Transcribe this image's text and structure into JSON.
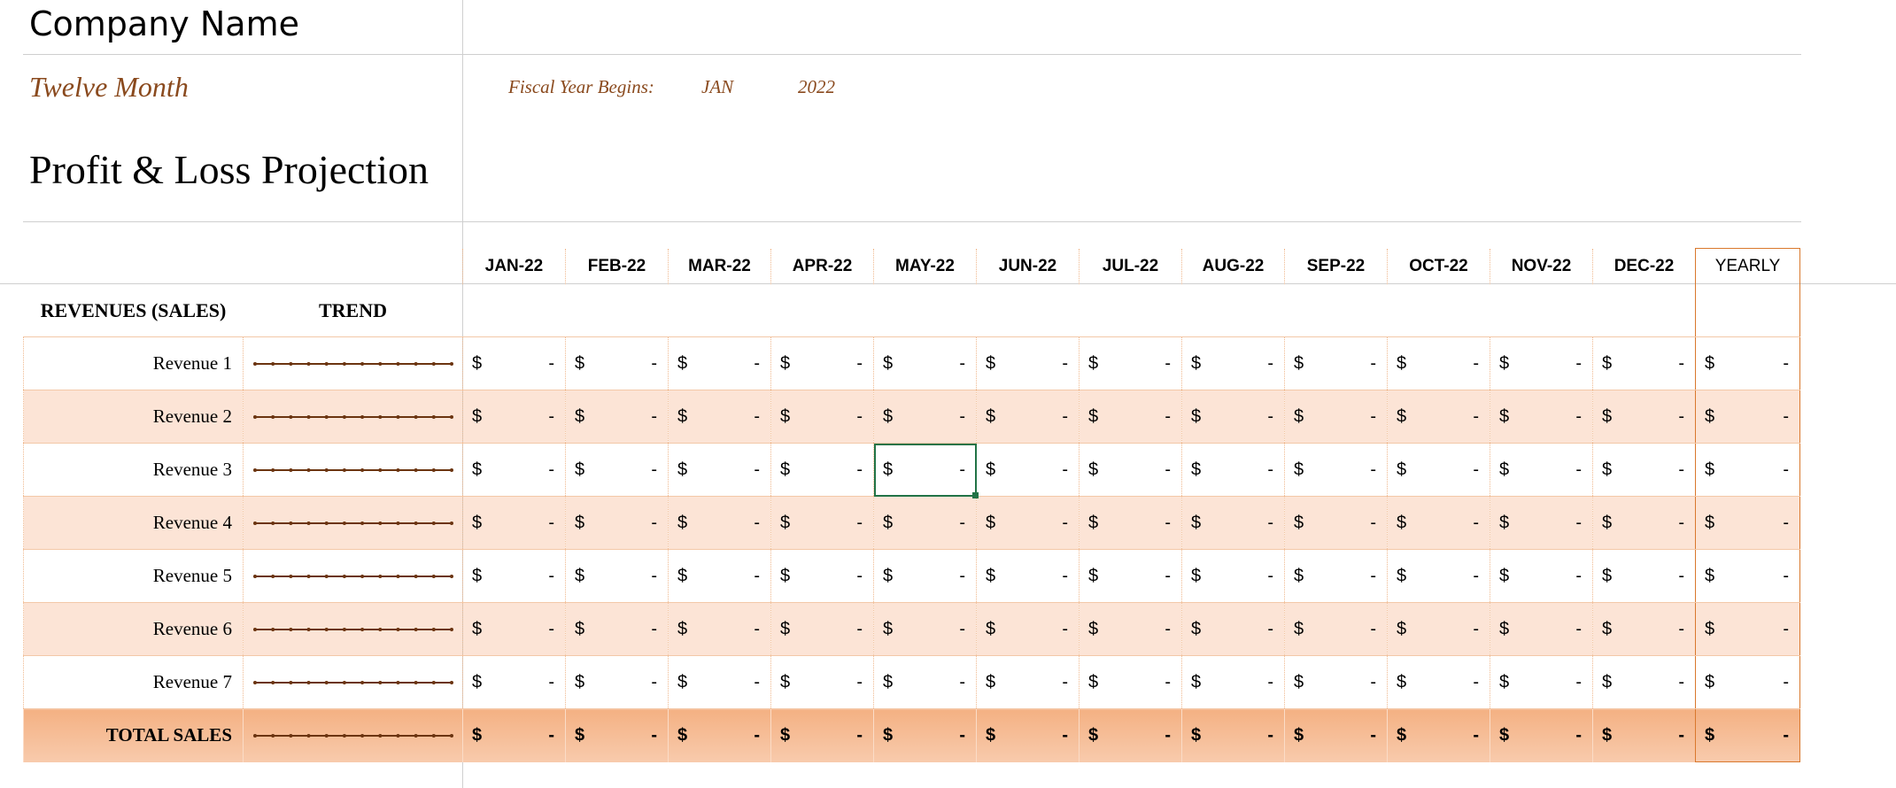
{
  "header": {
    "company_name": "Company Name",
    "subtitle": "Twelve Month",
    "title": "Profit & Loss Projection",
    "fiscal_label": "Fiscal Year Begins:",
    "fiscal_month": "JAN",
    "fiscal_year": "2022"
  },
  "columns": {
    "months": [
      "JAN-22",
      "FEB-22",
      "MAR-22",
      "APR-22",
      "MAY-22",
      "JUN-22",
      "JUL-22",
      "AUG-22",
      "SEP-22",
      "OCT-22",
      "NOV-22",
      "DEC-22"
    ],
    "yearly": "YEARLY"
  },
  "section": {
    "label": "REVENUES (SALES)",
    "trend_label": "TREND"
  },
  "currency_symbol": "$",
  "empty_value": "-",
  "rows": [
    {
      "label": "Revenue 1"
    },
    {
      "label": "Revenue 2"
    },
    {
      "label": "Revenue 3"
    },
    {
      "label": "Revenue 4"
    },
    {
      "label": "Revenue 5"
    },
    {
      "label": "Revenue 6"
    },
    {
      "label": "Revenue 7"
    }
  ],
  "total": {
    "label": "TOTAL SALES"
  },
  "selection": {
    "row": 3,
    "column": "MAY-22"
  },
  "colors": {
    "accent": "#8a4a1e",
    "row_alt": "#fce4d6",
    "total_fill": "#f4b183",
    "yearly_border": "#d9782d",
    "selection": "#217346",
    "sparkline": "#6b3410"
  }
}
